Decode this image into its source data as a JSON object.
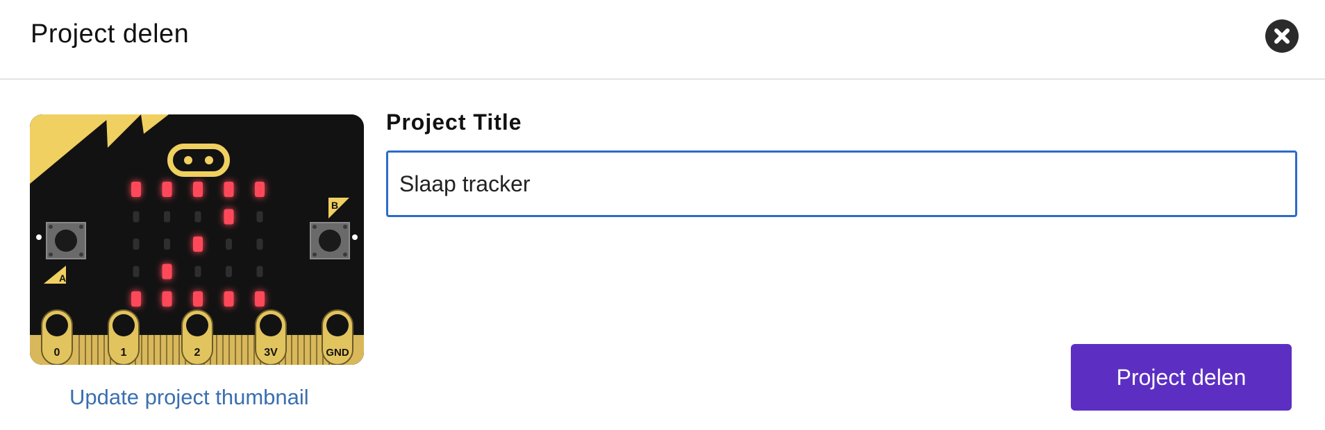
{
  "dialog": {
    "title": "Project delen",
    "close_icon": "close-icon"
  },
  "thumbnail": {
    "update_link": "Update project thumbnail",
    "button_a": "A",
    "button_b": "B",
    "pins": [
      "0",
      "1",
      "2",
      "3V",
      "GND"
    ],
    "led_grid": [
      [
        1,
        1,
        1,
        1,
        1
      ],
      [
        0,
        0,
        0,
        1,
        0
      ],
      [
        0,
        0,
        1,
        0,
        0
      ],
      [
        0,
        1,
        0,
        0,
        0
      ],
      [
        1,
        1,
        1,
        1,
        1
      ]
    ],
    "colors": {
      "board": "#121212",
      "gold": "#f0d060",
      "led_on": "#ff4a5a",
      "led_off": "#2e2e2e"
    }
  },
  "form": {
    "label": "Project Title",
    "title_value": "Slaap tracker"
  },
  "actions": {
    "share_label": "Project delen"
  },
  "colors": {
    "accent": "#5c2fc2",
    "input_border": "#2c6bc9",
    "link": "#3a6fb0"
  }
}
